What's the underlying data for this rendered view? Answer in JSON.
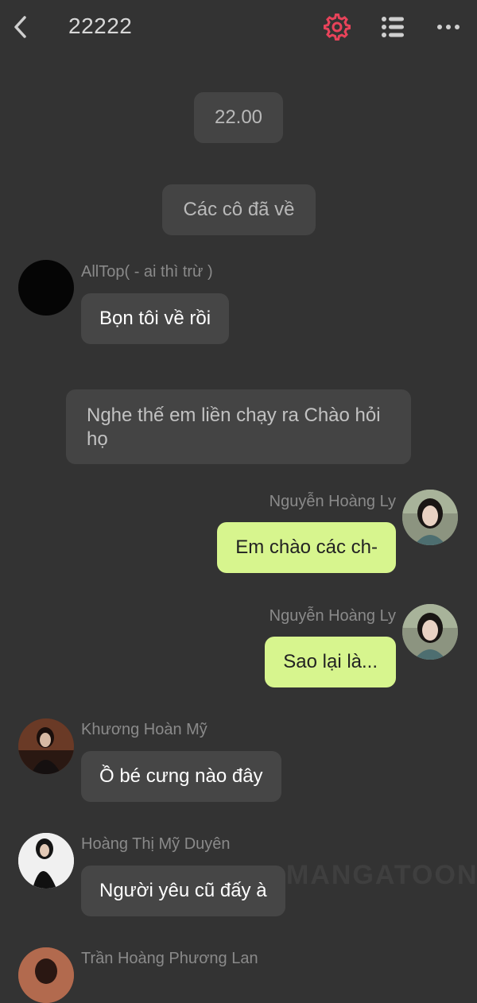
{
  "header": {
    "title": "22222",
    "icons": {
      "back": "back-arrow-icon",
      "settings": "gear-icon",
      "menu": "list-icon",
      "more": "more-dots-icon"
    },
    "accent_color": "#e8435a"
  },
  "system_messages": [
    {
      "text": "22.00"
    },
    {
      "text": "Các cô đã về"
    }
  ],
  "narration": [
    {
      "text": "Nghe thế em liền chạy ra Chào hỏi họ"
    }
  ],
  "messages": [
    {
      "sender": "AllTop( - ai thì trừ )",
      "text": "Bọn tôi về rồi",
      "side": "left"
    },
    {
      "sender": "Nguyễn Hoàng Ly",
      "text": "Em chào các ch-",
      "side": "right"
    },
    {
      "sender": "Nguyễn Hoàng Ly",
      "text": "Sao lại là...",
      "side": "right"
    },
    {
      "sender": "Khương Hoàn Mỹ",
      "text": "Ồ bé cưng nào đây",
      "side": "left"
    },
    {
      "sender": "Hoàng Thị Mỹ Duyên",
      "text": "Người yêu cũ đấy à",
      "side": "left"
    },
    {
      "sender": "Trần Hoàng Phương Lan",
      "text": "",
      "side": "left"
    }
  ],
  "watermark": "MANGATOON",
  "colors": {
    "background": "#333333",
    "bubble_left": "#464646",
    "bubble_right": "#d7f58e"
  }
}
